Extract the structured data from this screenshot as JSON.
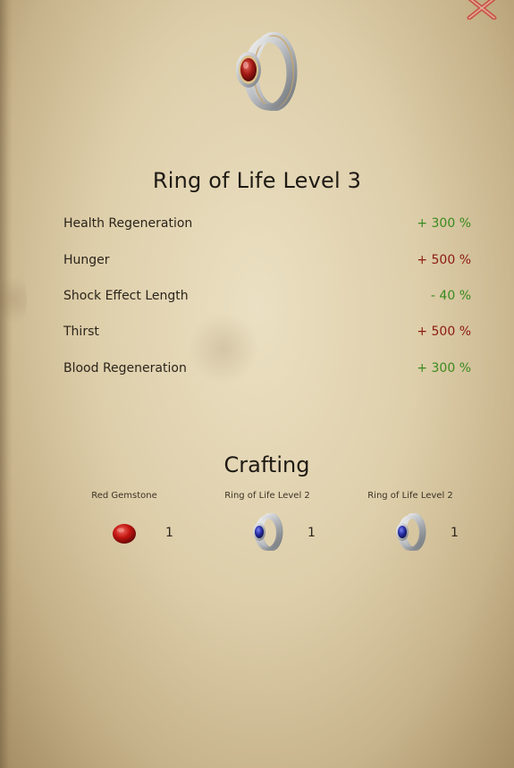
{
  "close": {
    "icon": "close-icon"
  },
  "item": {
    "icon": "ring-red-gem-icon",
    "title": "Ring of Life Level 3"
  },
  "stats": [
    {
      "label": "Health Regeneration",
      "value": "+ 300 %",
      "effect": "positive"
    },
    {
      "label": "Hunger",
      "value": "+ 500 %",
      "effect": "negative"
    },
    {
      "label": "Shock Effect Length",
      "value": "- 40 %",
      "effect": "positive"
    },
    {
      "label": "Thirst",
      "value": "+ 500 %",
      "effect": "negative"
    },
    {
      "label": "Blood Regeneration",
      "value": "+ 300 %",
      "effect": "positive"
    }
  ],
  "colors": {
    "positive": "#3a8a1e",
    "negative": "#8c1a10",
    "close": "#c9463a"
  },
  "crafting": {
    "title": "Crafting",
    "ingredients": [
      {
        "name": "Red Gemstone",
        "qty": "1",
        "icon": "red-gemstone-icon"
      },
      {
        "name": "Ring of Life Level 2",
        "qty": "1",
        "icon": "ring-blue-gem-icon"
      },
      {
        "name": "Ring of Life Level 2",
        "qty": "1",
        "icon": "ring-blue-gem-icon"
      }
    ]
  }
}
